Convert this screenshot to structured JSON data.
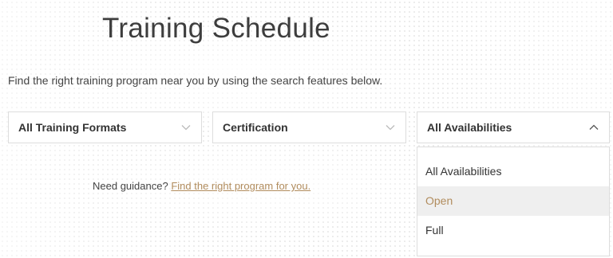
{
  "page": {
    "title": "Training Schedule",
    "subtitle": "Find the right training program near you by using the search features below."
  },
  "filters": {
    "format": {
      "value": "All Training Formats",
      "icon": "chevron-down-icon"
    },
    "certification": {
      "value": "Certification",
      "icon": "chevron-down-icon"
    },
    "availability": {
      "value": "All Availabilities",
      "icon": "chevron-up-icon",
      "open": true,
      "options": [
        "All Availabilities",
        "Open",
        "Full"
      ],
      "highlighted": "Open"
    }
  },
  "guidance": {
    "text": "Need guidance?",
    "link": "Find the right program for you."
  },
  "colors": {
    "accent": "#b18c5d",
    "border": "#dddddd",
    "hover_bg": "#efefef"
  }
}
